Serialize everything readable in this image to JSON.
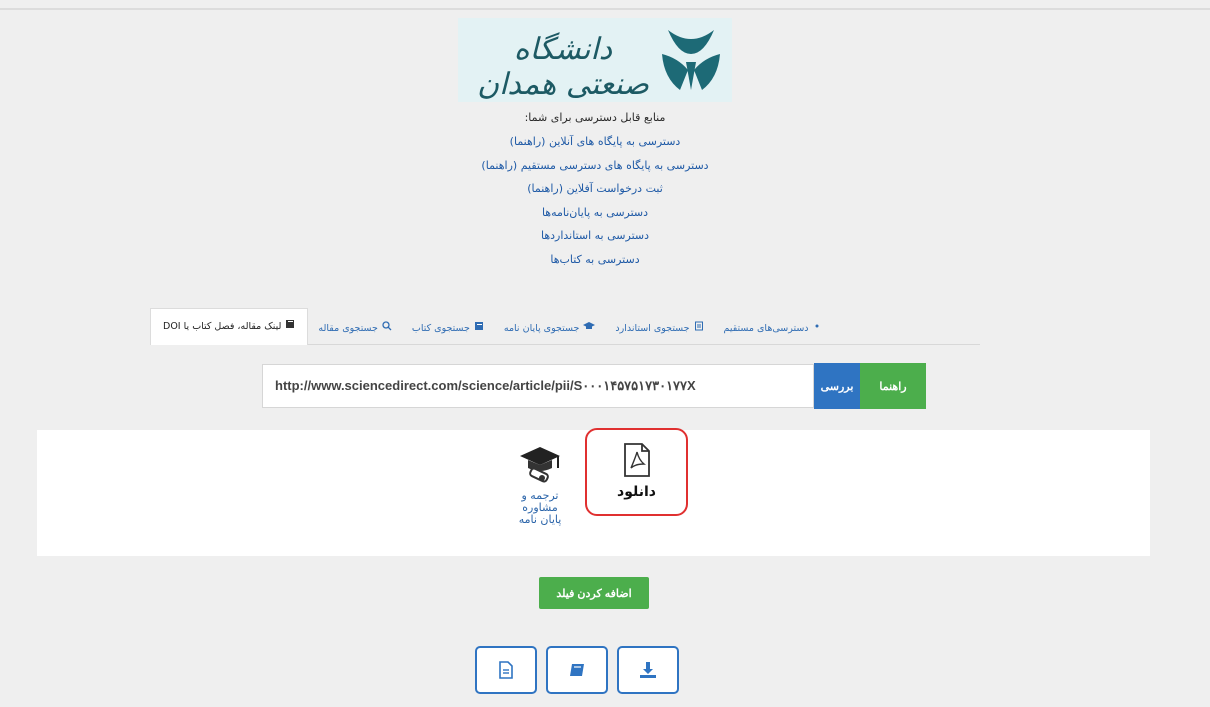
{
  "logo": {
    "text": "دانشگاه صنعتی همدان"
  },
  "intro": "منابع قابل دسترسی برای شما:",
  "links": [
    "دسترسی به پایگاه های آنلاین (راهنما)",
    "دسترسی به پایگاه های دسترسی مستقیم (راهنما)",
    "ثبت درخواست آفلاین (راهنما)",
    "دسترسی به پایان‌نامه‌ها",
    "دسترسی به استانداردها",
    "دسترسی به کتاب‌ها"
  ],
  "tabs": [
    {
      "label": "لینک مقاله، فصل کتاب یا DOI",
      "icon": "book-icon",
      "active": true
    },
    {
      "label": "جستجوی مقاله",
      "icon": "search-icon"
    },
    {
      "label": "جستجوی کتاب",
      "icon": "book-icon"
    },
    {
      "label": "جستجوی پایان نامه",
      "icon": "graduation-cap-icon"
    },
    {
      "label": "جستجوی استاندارد",
      "icon": "document-icon"
    },
    {
      "label": "دسترسی‌های مستقیم",
      "icon": "link-icon"
    }
  ],
  "url_input": {
    "value": "http://www.sciencedirect.com/science/article/pii/S۰۰۰۱۴۵۷۵۱۷۳۰۱۷۷X"
  },
  "buttons": {
    "check": "بررسی",
    "guide": "راهنما",
    "add_field": "اضافه کردن فیلد"
  },
  "services": {
    "download": {
      "label": "دانلود",
      "icon": "pdf-icon"
    },
    "translate": {
      "lines": [
        "ترجمه و",
        "مشاوره",
        "پایان نامه"
      ],
      "icon": "graduation-cap-icon"
    }
  },
  "tools": [
    {
      "icon": "document-icon"
    },
    {
      "icon": "book-icon"
    },
    {
      "icon": "download-icon"
    }
  ],
  "colors": {
    "accent_blue": "#2f74c2",
    "accent_green": "#4cae4c",
    "highlight_red": "#e03030"
  }
}
